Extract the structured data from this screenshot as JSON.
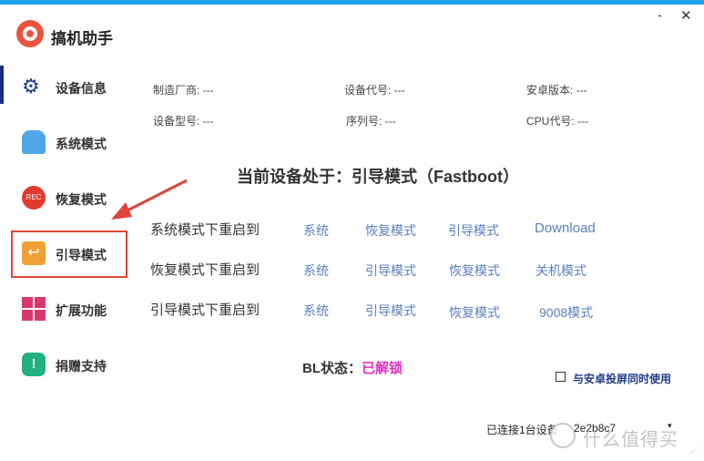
{
  "app": {
    "title": "搞机助手",
    "minimize": "-",
    "close": "✕"
  },
  "sidebar": {
    "items": [
      {
        "label": "设备信息",
        "icon": "gear-icon"
      },
      {
        "label": "系统模式",
        "icon": "android-icon"
      },
      {
        "label": "恢复模式",
        "icon": "rec-icon",
        "icon_text": "REC"
      },
      {
        "label": "引导模式",
        "icon": "back-arrow-icon",
        "icon_text": "↩"
      },
      {
        "label": "扩展功能",
        "icon": "grid-icon"
      },
      {
        "label": "捐赠支持",
        "icon": "info-icon",
        "icon_text": "!"
      }
    ],
    "active_index": 0,
    "highlighted_index": 3
  },
  "device_info": {
    "manufacturer": "制造厂商: ---",
    "device_code": "设备代号: ---",
    "android_version": "安卓版本: ---",
    "model": "设备型号: ---",
    "serial": "序列号: ---",
    "cpu": "CPU代号: ---"
  },
  "status": "当前设备处于：引导模式（Fastboot）",
  "reboot_rows": [
    {
      "label": "系统模式下重启到",
      "links": [
        "系统",
        "恢复模式",
        "引导模式",
        "Download"
      ]
    },
    {
      "label": "恢复模式下重启到",
      "links": [
        "系统",
        "引导模式",
        "恢复模式",
        "关机模式"
      ]
    },
    {
      "label": "引导模式下重启到",
      "links": [
        "系统",
        "引导模式",
        "恢复模式",
        "9008模式"
      ]
    }
  ],
  "bl": {
    "label": "BL状态：",
    "value": "已解锁"
  },
  "sync_option": {
    "label": "与安卓投屏同时使用",
    "checked": false
  },
  "connection": {
    "text": "已连接1台设备",
    "device_partial": "2e2b8c7",
    "caret": "▾"
  },
  "watermark": {
    "text": "什么值得买"
  },
  "colors": {
    "accent": "#1aa3e8",
    "link": "#5b80c0",
    "bl_unlocked": "#e52fc2",
    "annotation": "#e0453a"
  }
}
